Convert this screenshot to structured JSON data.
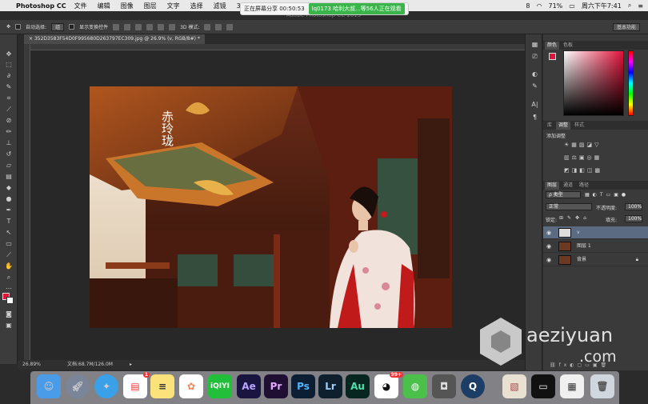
{
  "menubar": {
    "app_name": "Photoshop CC",
    "items": [
      "文件",
      "编辑",
      "图像",
      "图层",
      "文字",
      "选择",
      "滤镜",
      "3D"
    ],
    "battery": "71%",
    "time": "周六下午7:41",
    "input_source": "8"
  },
  "share_banner": {
    "status": "正在屏幕分享 00:50:53",
    "viewers": "lq0173 哈利大叔...等56人正在观看",
    "ghost_title": "Adobe Photoshop CC 2015"
  },
  "options_bar": {
    "auto_select_label": "自动选择:",
    "auto_select_value": "组",
    "show_transform_label": "显示变换控件",
    "mode_3d_label": "3D 模式:",
    "workspace": "基本功能"
  },
  "document": {
    "tab_title": "352D3583F54D0F995680D263797EC309.jpg @ 26.9% (v, RGB/8#) *",
    "zoom": "26.89%",
    "doc_size": "文档:68.7M/126.0M"
  },
  "panels": {
    "color_tabs": [
      "颜色",
      "色板"
    ],
    "adjust_tabs": [
      "库",
      "调整",
      "样式"
    ],
    "adjust_title": "添加调整",
    "layers_tabs": [
      "图层",
      "通道",
      "路径"
    ],
    "kind_filter": "ρ 类型",
    "blend_mode": "正常",
    "opacity_label": "不透明度:",
    "opacity_value": "100%",
    "lock_label": "锁定:",
    "fill_label": "填充:",
    "fill_value": "100%",
    "layers": [
      {
        "name": "v",
        "selected": true
      },
      {
        "name": "图层 1",
        "selected": false
      },
      {
        "name": "背景",
        "selected": false,
        "locked": true
      }
    ]
  },
  "photo": {
    "calligraphy": "赤玲珑"
  },
  "watermark": {
    "line1": "aeziyuan",
    "line2": ".com"
  },
  "dock": {
    "apps": [
      "Finder",
      "Launchpad",
      "Safari",
      "Calendar",
      "Notes",
      "Photos",
      "iQIYI",
      "Ae",
      "Pr",
      "Ps",
      "Lr",
      "Au",
      "QQ",
      "WeChat",
      "Screenshot",
      "QuickTime",
      "Preview",
      "Terminal",
      "Image",
      "Trash"
    ],
    "qq_badge": "99+",
    "calendar_badge": "1"
  },
  "colors": {
    "foreground": "#e3123a",
    "accent_selected_layer": "#5a6b82"
  }
}
